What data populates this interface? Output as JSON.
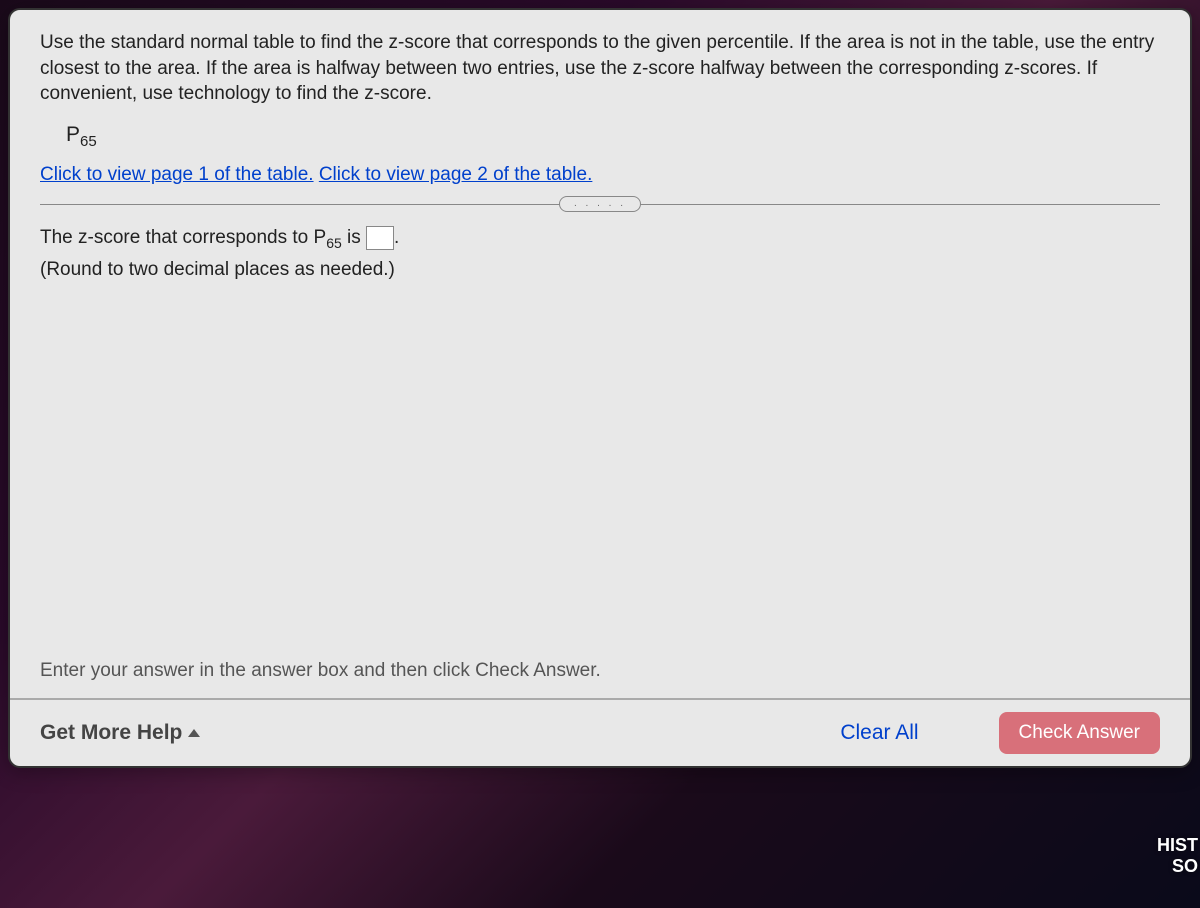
{
  "instructions": "Use the standard normal table to find the z-score that corresponds to the given percentile. If the area is not in the table, use the entry closest to the area. If the area is halfway between two entries, use the z-score halfway between the corresponding z-scores. If convenient, use technology to find the z-score.",
  "percentile": {
    "prefix": "P",
    "subscript": "65"
  },
  "links": {
    "page1": "Click to view page 1 of the table.",
    "page2": "Click to view page 2 of the table."
  },
  "collapse_dots": ". . . . .",
  "answer_prompt": {
    "before": "The z-score that corresponds to P",
    "subscript": "65",
    "after_sub": " is ",
    "after_input": "."
  },
  "answer_value": "",
  "round_note": "(Round to two decimal places as needed.)",
  "enter_hint": "Enter your answer in the answer box and then click Check Answer.",
  "buttons": {
    "get_more_help": "Get More Help",
    "clear_all": "Clear All",
    "check_answer": "Check Answer"
  },
  "corner": {
    "line1": "HIST",
    "line2": "SO"
  }
}
